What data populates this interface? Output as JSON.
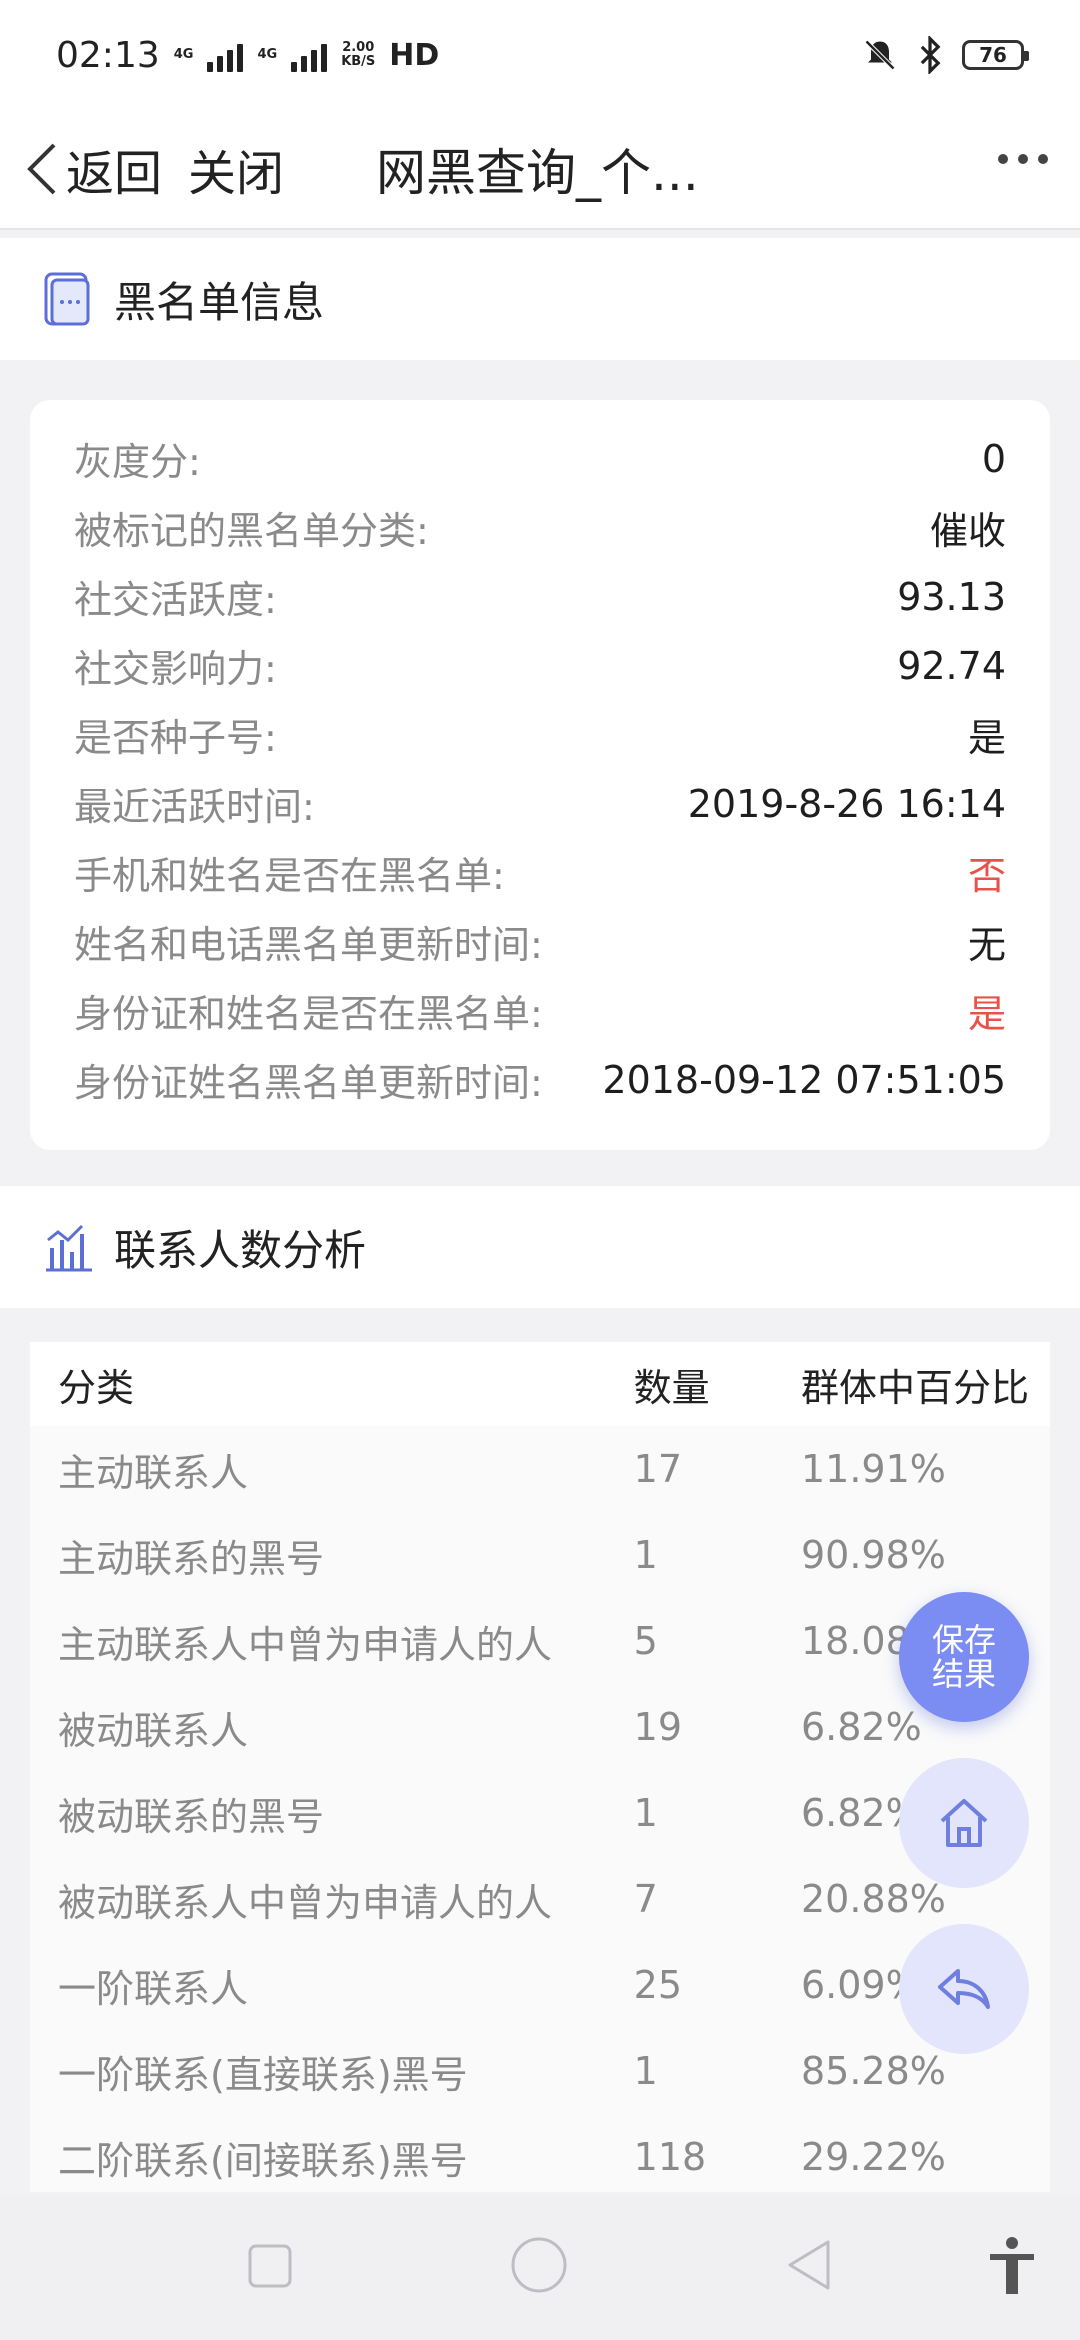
{
  "status_bar": {
    "time": "02:13",
    "network_1": "4G",
    "network_2": "4G",
    "speed_value": "2.00",
    "speed_unit": "KB/S",
    "hd_label": "HD",
    "battery": "76"
  },
  "nav": {
    "back_label": "返回",
    "close_label": "关闭",
    "title": "网黑查询_个..."
  },
  "blacklist_section": {
    "title": "黑名单信息",
    "rows": [
      {
        "label": "灰度分:",
        "value": "0",
        "highlight": false
      },
      {
        "label": "被标记的黑名单分类:",
        "value": "催收",
        "highlight": false
      },
      {
        "label": "社交活跃度:",
        "value": "93.13",
        "highlight": false
      },
      {
        "label": "社交影响力:",
        "value": "92.74",
        "highlight": false
      },
      {
        "label": "是否种子号:",
        "value": "是",
        "highlight": false
      },
      {
        "label": "最近活跃时间:",
        "value": "2019-8-26 16:14",
        "highlight": false
      },
      {
        "label": "手机和姓名是否在黑名单:",
        "value": "否",
        "highlight": true
      },
      {
        "label": "姓名和电话黑名单更新时间:",
        "value": "无",
        "highlight": false
      },
      {
        "label": "身份证和姓名是否在黑名单:",
        "value": "是",
        "highlight": true
      },
      {
        "label": "身份证姓名黑名单更新时间:",
        "value": "2018-09-12 07:51:05",
        "highlight": false
      }
    ]
  },
  "contacts_section": {
    "title": "联系人数分析",
    "headers": [
      "分类",
      "数量",
      "群体中百分比"
    ],
    "rows": [
      [
        "主动联系人",
        "17",
        "11.91%"
      ],
      [
        "主动联系的黑号",
        "1",
        "90.98%"
      ],
      [
        "主动联系人中曾为申请人的人",
        "5",
        "18.08%"
      ],
      [
        "被动联系人",
        "19",
        "6.82%"
      ],
      [
        "被动联系的黑号",
        "1",
        "6.82%"
      ],
      [
        "被动联系人中曾为申请人的人",
        "7",
        "20.88%"
      ],
      [
        "一阶联系人",
        "25",
        "6.09%"
      ],
      [
        "一阶联系(直接联系)黑号",
        "1",
        "85.28%"
      ],
      [
        "二阶联系(间接联系)黑号",
        "118",
        "29.22%"
      ]
    ]
  },
  "fabs": {
    "save_line1": "保存",
    "save_line2": "结果",
    "home_icon": "home-icon",
    "back_icon": "reply-arrow-icon"
  },
  "colors": {
    "accent": "#7b8cf2",
    "highlight_red": "#e8524a",
    "icon_blue": "#5b6fd6"
  }
}
